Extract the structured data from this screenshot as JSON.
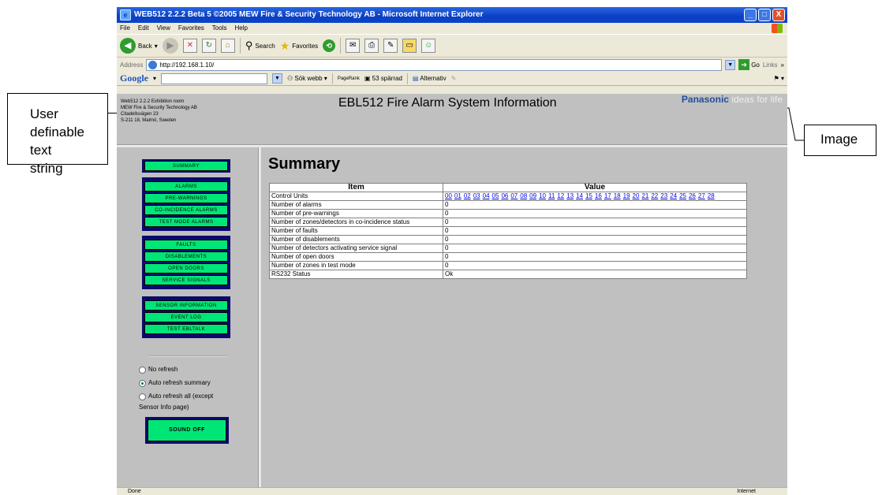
{
  "callouts": {
    "left_lines": [
      "User",
      "definable",
      "text",
      "string"
    ],
    "right": "Image"
  },
  "window": {
    "title": "WEB512 2.2.2 Beta 5 ©2005 MEW Fire & Security Technology AB - Microsoft Internet Explorer",
    "controls": [
      "_",
      "□",
      "X"
    ]
  },
  "menu": [
    "File",
    "Edit",
    "View",
    "Favorites",
    "Tools",
    "Help"
  ],
  "toolbar": {
    "back": "Back",
    "search": "Search",
    "favorites": "Favorites"
  },
  "address": {
    "label": "Address",
    "url": "http://192.168.1.10/",
    "go": "Go",
    "links": "Links"
  },
  "googlebar": {
    "logo": "Google",
    "search": "Sök webb",
    "pagerank": "PageRank",
    "blocked": "53 spärrad",
    "options": "Alternativ"
  },
  "header": {
    "info_lines": [
      "Web512 2.2.2 Exhibition room",
      "MEW Fire & Security Technology AB",
      "Citadellsvägen 23",
      "S-211 18, Malmö, Sweden"
    ],
    "title": "EBL512 Fire Alarm System Information",
    "logo_brand": "Panasonic",
    "logo_tag": "ideas for life"
  },
  "nav": {
    "summary": "SUMMARY",
    "alarms": "ALARMS",
    "prewarnings": "PRE-WARNINGS",
    "coincidence": "CO-INCIDENCE ALARMS",
    "testmode": "TEST MODE ALARMS",
    "faults": "FAULTS",
    "disablements": "DISABLEMENTS",
    "opendoors": "OPEN DOORS",
    "service": "SERVICE SIGNALS",
    "sensor": "SENSOR INFORMATION",
    "eventlog": "EVENT LOG",
    "testebl": "TEST EBLTALK",
    "radios": [
      "No refresh",
      "Auto refresh summary",
      "Auto refresh all (except",
      "Sensor Info page)"
    ],
    "sound_off": "SOUND OFF"
  },
  "content": {
    "heading": "Summary",
    "columns": [
      "Item",
      "Value"
    ],
    "control_units_label": "Control Units",
    "control_units": [
      "00",
      "01",
      "02",
      "03",
      "04",
      "05",
      "06",
      "07",
      "08",
      "09",
      "10",
      "11",
      "12",
      "13",
      "14",
      "15",
      "16",
      "17",
      "18",
      "19",
      "20",
      "21",
      "22",
      "23",
      "24",
      "25",
      "26",
      "27",
      "28"
    ],
    "rows": [
      {
        "item": "Number of alarms",
        "value": "0"
      },
      {
        "item": "Number of pre-warnings",
        "value": "0"
      },
      {
        "item": "Number of zones/detectors in co-incidence status",
        "value": "0"
      },
      {
        "item": "Number of faults",
        "value": "0"
      },
      {
        "item": "Number of disablements",
        "value": "0"
      },
      {
        "item": "Number of detectors activating service signal",
        "value": "0"
      },
      {
        "item": "Number of open doors",
        "value": "0"
      },
      {
        "item": "Number of zones in test mode",
        "value": "0"
      },
      {
        "item": "RS232 Status",
        "value": "Ok"
      }
    ]
  },
  "status": {
    "left": "Done",
    "zone": "Internet"
  }
}
